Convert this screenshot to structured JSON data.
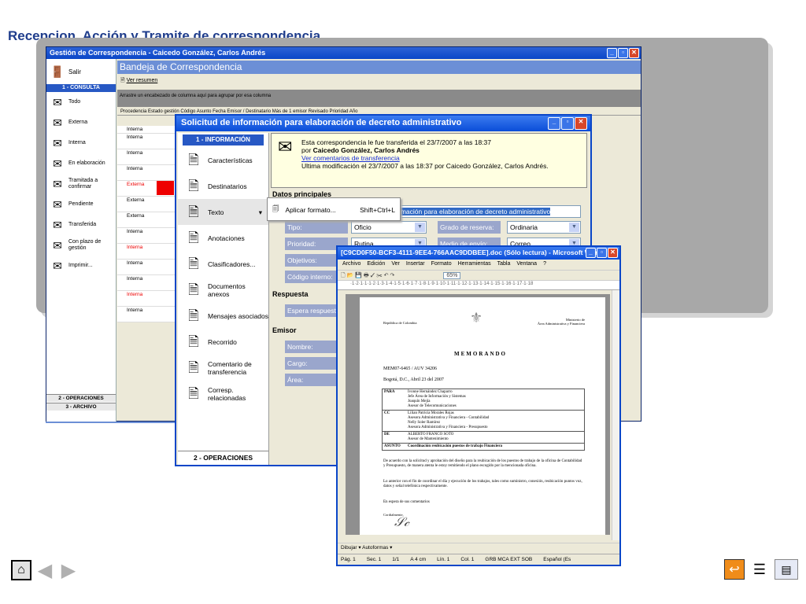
{
  "slide": {
    "title": "Recepcion, Acción y Tramite de correspondencia"
  },
  "main_window": {
    "title": "Gestión de Correspondencia - Caicedo González, Carlos Andrés",
    "exit_label": "Salir",
    "sections": {
      "consulta": "1 - CONSULTA",
      "operaciones": "2 - OPERACIONES",
      "archivo": "3 - ARCHIVO"
    },
    "nav_items": [
      {
        "label": "Todo",
        "icon": "inbox-all-icon"
      },
      {
        "label": "Externa",
        "icon": "external-mail-icon"
      },
      {
        "label": "Interna",
        "icon": "internal-mail-icon"
      },
      {
        "label": "En elaboración",
        "icon": "drafting-icon"
      },
      {
        "label": "Tramitada a confirmar",
        "icon": "pending-confirm-icon"
      },
      {
        "label": "Pendiente",
        "icon": "pending-icon"
      },
      {
        "label": "Transferida",
        "icon": "transfer-icon"
      },
      {
        "label": "Con plazo de gestión",
        "icon": "deadline-icon"
      },
      {
        "label": "Imprimir...",
        "icon": "print-icon"
      }
    ],
    "inbox_title": "Bandeja de Correspondencia",
    "ver_resumen": "Ver resumen",
    "group_hint": "Arrastre un encabezado de columna aquí para agrupar por esa columna",
    "columns": "Procedencia  Estado gestión    Código                        Asunto                                    Fecha        Emisor / Destinatario    Más de 1 emisor  Revisado   Prioridad   Año",
    "rows": [
      "Interna",
      "Interna",
      "Interna",
      "Interna",
      "Externa",
      "Externa",
      "Externa",
      "Interna",
      "Interna",
      "Interna",
      "Interna",
      "Interna",
      "Interna"
    ],
    "red_rows": [
      4,
      8,
      11
    ]
  },
  "dialog": {
    "title": "Solicitud de información para elaboración de decreto administrativo",
    "info_header": "1 - INFORMACIÓN",
    "ops_footer": "2 - OPERACIONES",
    "tabs": [
      {
        "label": "Características",
        "icon": "characteristics-icon"
      },
      {
        "label": "Destinatarios",
        "icon": "recipients-icon"
      },
      {
        "label": "Texto",
        "icon": "text-icon"
      },
      {
        "label": "Anotaciones",
        "icon": "notes-icon"
      },
      {
        "label": "Clasificadores...",
        "icon": "classifiers-icon"
      },
      {
        "label": "Documentos anexos",
        "icon": "attachments-icon"
      },
      {
        "label": "Mensajes asociados",
        "icon": "messages-icon"
      },
      {
        "label": "Recorrido",
        "icon": "route-icon"
      },
      {
        "label": "Comentario de transferencia",
        "icon": "comment-icon"
      },
      {
        "label": "Corresp. relacionadas",
        "icon": "related-icon"
      }
    ],
    "info_line1": "Esta correspondencia le fue transferida el 23/7/2007 a las 18:37",
    "info_line2_prefix": "por ",
    "info_line2_name": "Caicedo González, Carlos Andrés",
    "info_link": "Ver comentarios de transferencia",
    "info_line4": "Ultima modificación el 23/7/2007 a las 18:37 por Caicedo González, Carlos Andrés.",
    "sections": {
      "datos": "Datos principales",
      "respuesta": "Respuesta",
      "emisor": "Emisor"
    },
    "fields": {
      "asunto_val": "rmación para elaboración de decreto administrativo",
      "tipo": "Tipo:",
      "tipo_val": "Oficio",
      "grado": "Grado de reserva:",
      "grado_val": "Ordinaria",
      "prioridad": "Prioridad:",
      "prioridad_val": "Rutina",
      "medio": "Medio de envío:",
      "medio_val": "Correo",
      "objetivos": "Objetivos:",
      "codigo": "Código interno:",
      "espera": "Espera respuesta",
      "nombre": "Nombre:",
      "cargo": "Cargo:",
      "area": "Área:"
    },
    "context_menu": {
      "label": "Aplicar formato...",
      "shortcut": "Shift+Ctrl+L"
    }
  },
  "word": {
    "title": "[C9CD0F50-BCF3-4111-9EE4-766AAC9DDBEE].doc (Sólo lectura) - Microsoft Word",
    "menu": [
      "Archivo",
      "Edición",
      "Ver",
      "Insertar",
      "Formato",
      "Herramientas",
      "Tabla",
      "Ventana",
      "?"
    ],
    "zoom": "65%",
    "header_left": "República de Colombia",
    "header_right": "Ministerio de\nÁrea Administrativa y Financiera",
    "doc_title": "MEMORANDO",
    "ref": "MEM07-6465 / AUV 34206",
    "date": "Bogotá, D.C., Abril 23 del 2007",
    "para_label": "PARA",
    "para_lines": [
      "Ivonne Hernández Chaparro",
      "Jefe Área de Información y Sistemas",
      "Joaquín Mejía",
      "Asesor de Telecomunicaciones"
    ],
    "cc_label": "CC",
    "cc_lines": [
      "Lilian Patricia Morales Rojas",
      "Asesora Administrativa y Financiera - Contabilidad",
      "Nelly Soler Ramírez",
      "Asesora Administrativa y Financiera - Presupuesto"
    ],
    "de_label": "DE",
    "de_lines": [
      "ALBERTO FRANCO SOTO",
      "Asesor de Mantenimiento"
    ],
    "asunto_label": "ASUNTO",
    "asunto": "Coordinación reubicación puestos de trabajo Financiera",
    "body1": "De acuerdo con la solicitud y aprobación del diseño para la reubicación de los puestos de trabajo de la oficina de Contabilidad y Presupuesto, de manera atenta le estoy remitiendo el plano escogido por la mencionada oficina.",
    "body2": "Lo anterior con el fin de coordinar el día y ejecución de los trabajos, tales como suministro, conexión, reubicación puntos voz, datos y señal telefónica respectivamente.",
    "body3": "En espera de sus comentarios",
    "closing": "Cordialmente,",
    "draw_bar": "Dibujar ▾   Autoformas ▾",
    "status": [
      "Pág. 1",
      "Sec. 1",
      "1/1",
      "A 4 cm",
      "Lín. 1",
      "Col. 1",
      "GRB  MCA  EXT  SOB",
      "Español (Es"
    ]
  }
}
